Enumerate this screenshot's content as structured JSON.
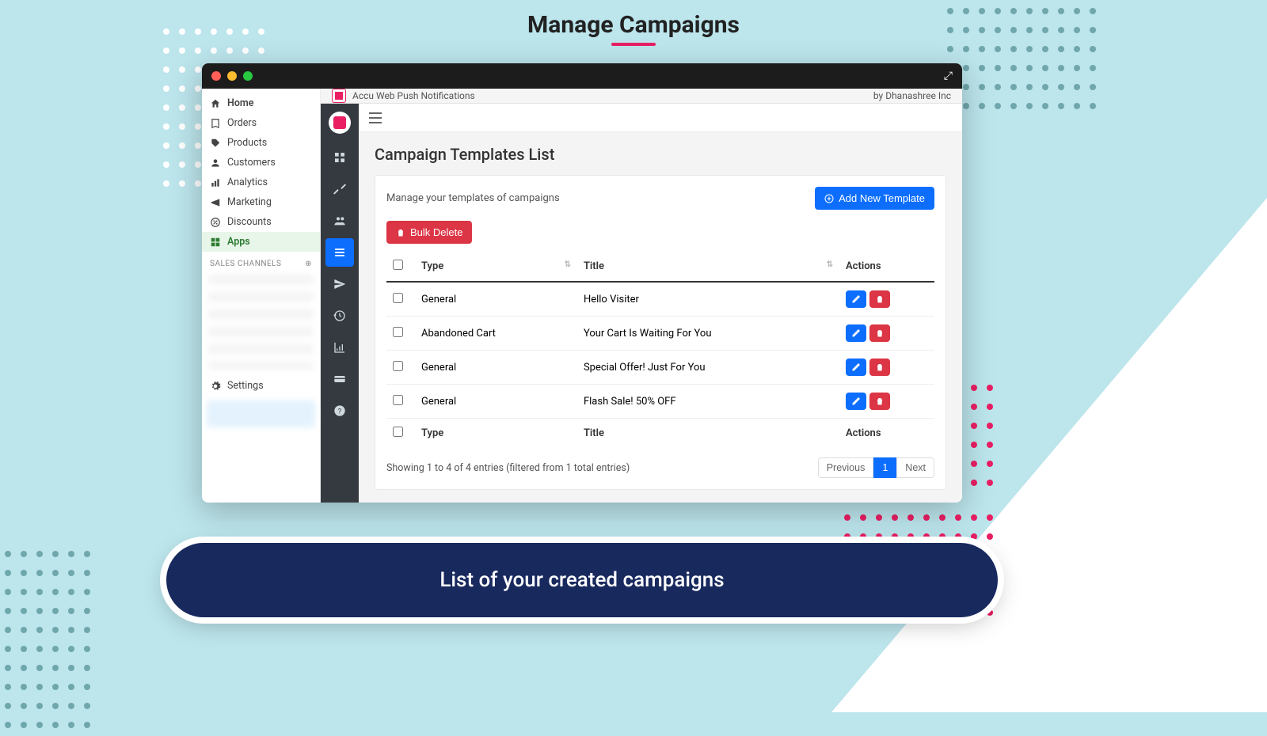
{
  "page": {
    "title": "Manage Campaigns",
    "caption": "List of your created campaigns"
  },
  "window": {
    "app_name": "Accu Web Push Notifications",
    "byline": "by Dhanashree Inc"
  },
  "shopify_nav": {
    "items": [
      {
        "label": "Home"
      },
      {
        "label": "Orders"
      },
      {
        "label": "Products"
      },
      {
        "label": "Customers"
      },
      {
        "label": "Analytics"
      },
      {
        "label": "Marketing"
      },
      {
        "label": "Discounts"
      },
      {
        "label": "Apps"
      }
    ],
    "section_header": "SALES CHANNELS",
    "settings_label": "Settings"
  },
  "templates": {
    "heading": "Campaign Templates List",
    "subheading": "Manage your templates of campaigns",
    "add_button": "Add New Template",
    "bulk_delete": "Bulk Delete",
    "columns": {
      "type": "Type",
      "title": "Title",
      "actions": "Actions"
    },
    "rows": [
      {
        "type": "General",
        "title": "Hello Visiter"
      },
      {
        "type": "Abandoned Cart",
        "title": "Your Cart Is Waiting For You"
      },
      {
        "type": "General",
        "title": "Special Offer! Just For You"
      },
      {
        "type": "General",
        "title": "Flash Sale! 50% OFF"
      }
    ],
    "footer_info": "Showing 1 to 4 of 4 entries (filtered from 1 total entries)",
    "pager": {
      "prev": "Previous",
      "page": "1",
      "next": "Next"
    }
  }
}
